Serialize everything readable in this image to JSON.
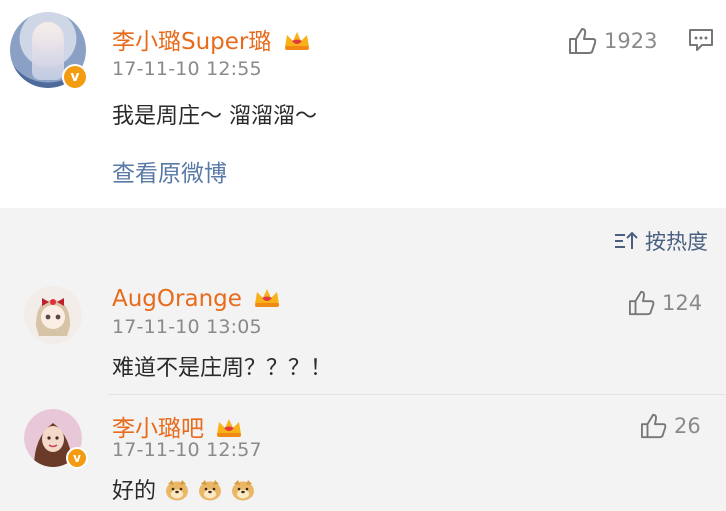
{
  "post": {
    "author": "李小璐Super璐",
    "time": "17-11-10 12:55",
    "text": "我是周庄～ 溜溜溜～",
    "view_original": "查看原微博",
    "likes": "1923"
  },
  "sort": {
    "label": "按热度"
  },
  "comments": [
    {
      "author": "AugOrange",
      "time": "17-11-10 13:05",
      "text": "难道不是庄周？？？！",
      "likes": "124"
    },
    {
      "author": "李小璐吧",
      "time": "17-11-10 12:57",
      "text": "好的",
      "likes": "26"
    }
  ],
  "colors": {
    "username": "#e86b1b",
    "link": "#5a7aa6",
    "badge": "#f39c12"
  },
  "icons": [
    "thumbs-up-icon",
    "comment-icon",
    "sort-icon",
    "crown-badge-icon",
    "verified-badge-icon",
    "doge-emoji-icon"
  ]
}
